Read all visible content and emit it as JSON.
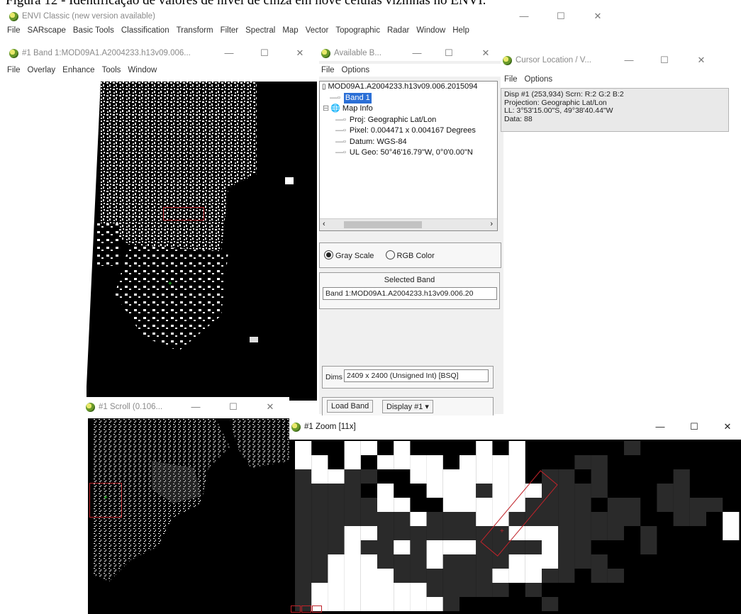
{
  "caption": "Figura 12 - Identificação de valores de nível de cinza em nove células vizinhas no ENVI.",
  "main_window": {
    "title": "ENVI Classic (new version available)",
    "menu": [
      "File",
      "SARscape",
      "Basic Tools",
      "Classification",
      "Transform",
      "Filter",
      "Spectral",
      "Map",
      "Vector",
      "Topographic",
      "Radar",
      "Window",
      "Help"
    ]
  },
  "image_window": {
    "title": "#1 Band 1:MOD09A1.A2004233.h13v09.006...",
    "menu": [
      "File",
      "Overlay",
      "Enhance",
      "Tools",
      "Window"
    ]
  },
  "bands_window": {
    "title": "Available B...",
    "menu": [
      "File",
      "Options"
    ],
    "tree": {
      "root": "MOD09A1.A2004233.h13v09.006.2015094",
      "band": "Band 1",
      "map_info": "Map Info",
      "proj": "Proj: Geographic Lat/Lon",
      "pixel": "Pixel: 0.004471 x 0.004167 Degrees",
      "datum": "Datum: WGS-84",
      "ul_geo": "UL Geo: 50°46'16.79\"W, 0°0'0.00\"N"
    },
    "gray_scale": "Gray Scale",
    "rgb_color": "RGB Color",
    "selected_band_label": "Selected Band",
    "selected_band_value": "Band 1:MOD09A1.A2004233.h13v09.006.20",
    "dims_label": "Dims",
    "dims_value": "2409 x 2400 (Unsigned Int) [BSQ]",
    "load_band": "Load Band",
    "display": "Display #1"
  },
  "cursor_window": {
    "title": "Cursor Location / V...",
    "menu": [
      "File",
      "Options"
    ],
    "lines": [
      "Disp #1 (253,934) Scrn: R:2 G:2 B:2",
      "Projection: Geographic Lat/Lon",
      "LL: 3°53'15.00\"S, 49°38'40.44\"W",
      "Data: 88"
    ]
  },
  "scroll_window": {
    "title": "#1 Scroll (0.106..."
  },
  "zoom_window": {
    "title": "#1 Zoom [11x]"
  },
  "colors": {
    "selection": "#2b6fd6",
    "roi_red": "#c0232a",
    "cursor_green": "#22dd22"
  }
}
